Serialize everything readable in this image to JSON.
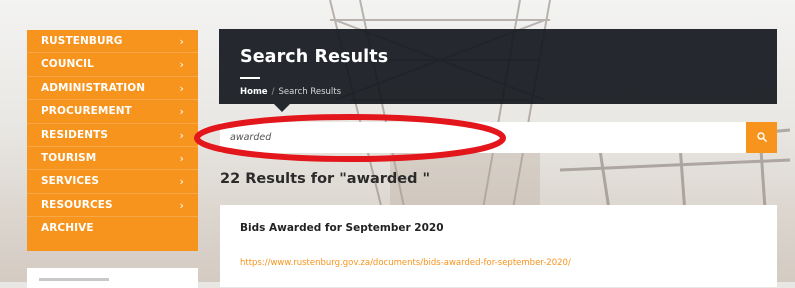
{
  "sidebar": {
    "items": [
      {
        "label": "RUSTENBURG",
        "chevron": "›"
      },
      {
        "label": "COUNCIL",
        "chevron": "›"
      },
      {
        "label": "ADMINISTRATION",
        "chevron": "›"
      },
      {
        "label": "PROCUREMENT",
        "chevron": "›"
      },
      {
        "label": "RESIDENTS",
        "chevron": "›"
      },
      {
        "label": "TOURISM",
        "chevron": "›"
      },
      {
        "label": "SERVICES",
        "chevron": "›"
      },
      {
        "label": "RESOURCES",
        "chevron": "›"
      },
      {
        "label": "ARCHIVE",
        "chevron": ""
      }
    ]
  },
  "header": {
    "title": "Search Results",
    "breadcrumb": {
      "home": "Home",
      "separator": "/",
      "current": "Search Results"
    }
  },
  "search": {
    "value": "awarded",
    "button_icon": "search-icon"
  },
  "results": {
    "heading": "22 Results for \"awarded \"",
    "items": [
      {
        "title": "Bids Awarded for September 2020",
        "url": "https://www.rustenburg.gov.za/documents/bids-awarded-for-september-2020/"
      }
    ]
  },
  "colors": {
    "accent": "#f7941d",
    "header_bg": "#14181e",
    "annotation": "#e3161b"
  }
}
